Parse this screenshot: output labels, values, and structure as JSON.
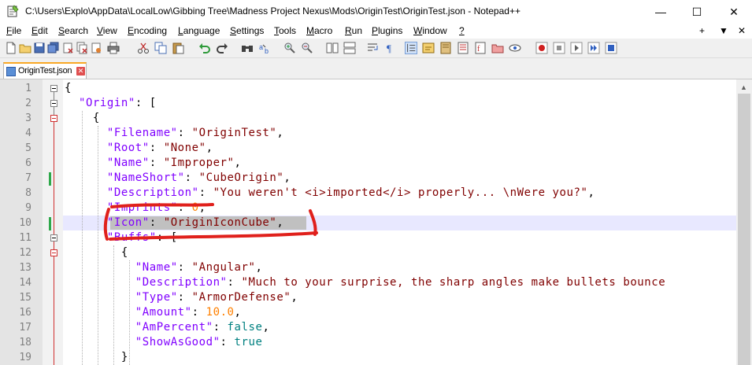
{
  "window": {
    "title": "C:\\Users\\Explo\\AppData\\LocalLow\\Gibbing Tree\\Madness Project Nexus\\Mods\\OriginTest\\OriginTest.json - Notepad++",
    "minimize": "—",
    "maximize": "☐",
    "close": "✕"
  },
  "menu": {
    "items": [
      {
        "label": "File",
        "accel": "F",
        "rest": "ile"
      },
      {
        "label": "Edit",
        "accel": "E",
        "rest": "dit"
      },
      {
        "label": "Search",
        "accel": "S",
        "rest": "earch"
      },
      {
        "label": "View",
        "accel": "V",
        "rest": "iew"
      },
      {
        "label": "Encoding",
        "accel": "E",
        "rest": "ncoding"
      },
      {
        "label": "Language",
        "accel": "L",
        "rest": "anguage"
      },
      {
        "label": "Settings",
        "accel": "S",
        "rest": "ettings"
      },
      {
        "label": "Tools",
        "accel": "T",
        "rest": "ools"
      },
      {
        "label": "Macro",
        "accel": "M",
        "rest": "acro"
      },
      {
        "label": "Run",
        "accel": "R",
        "rest": "un"
      },
      {
        "label": "Plugins",
        "accel": "P",
        "rest": "lugins"
      },
      {
        "label": "Window",
        "accel": "W",
        "rest": "indow"
      },
      {
        "label": "?",
        "accel": "?",
        "rest": ""
      }
    ],
    "right": [
      "+",
      "▼",
      "✕"
    ]
  },
  "tab": {
    "label": "OriginTest.json",
    "close": "✕"
  },
  "editor": {
    "line_numbers": [
      "1",
      "2",
      "3",
      "4",
      "5",
      "6",
      "7",
      "8",
      "9",
      "10",
      "11",
      "12",
      "13",
      "14",
      "15",
      "16",
      "17",
      "18",
      "19"
    ],
    "current_line": 10
  },
  "annotation": {
    "color": "#e0201c"
  }
}
